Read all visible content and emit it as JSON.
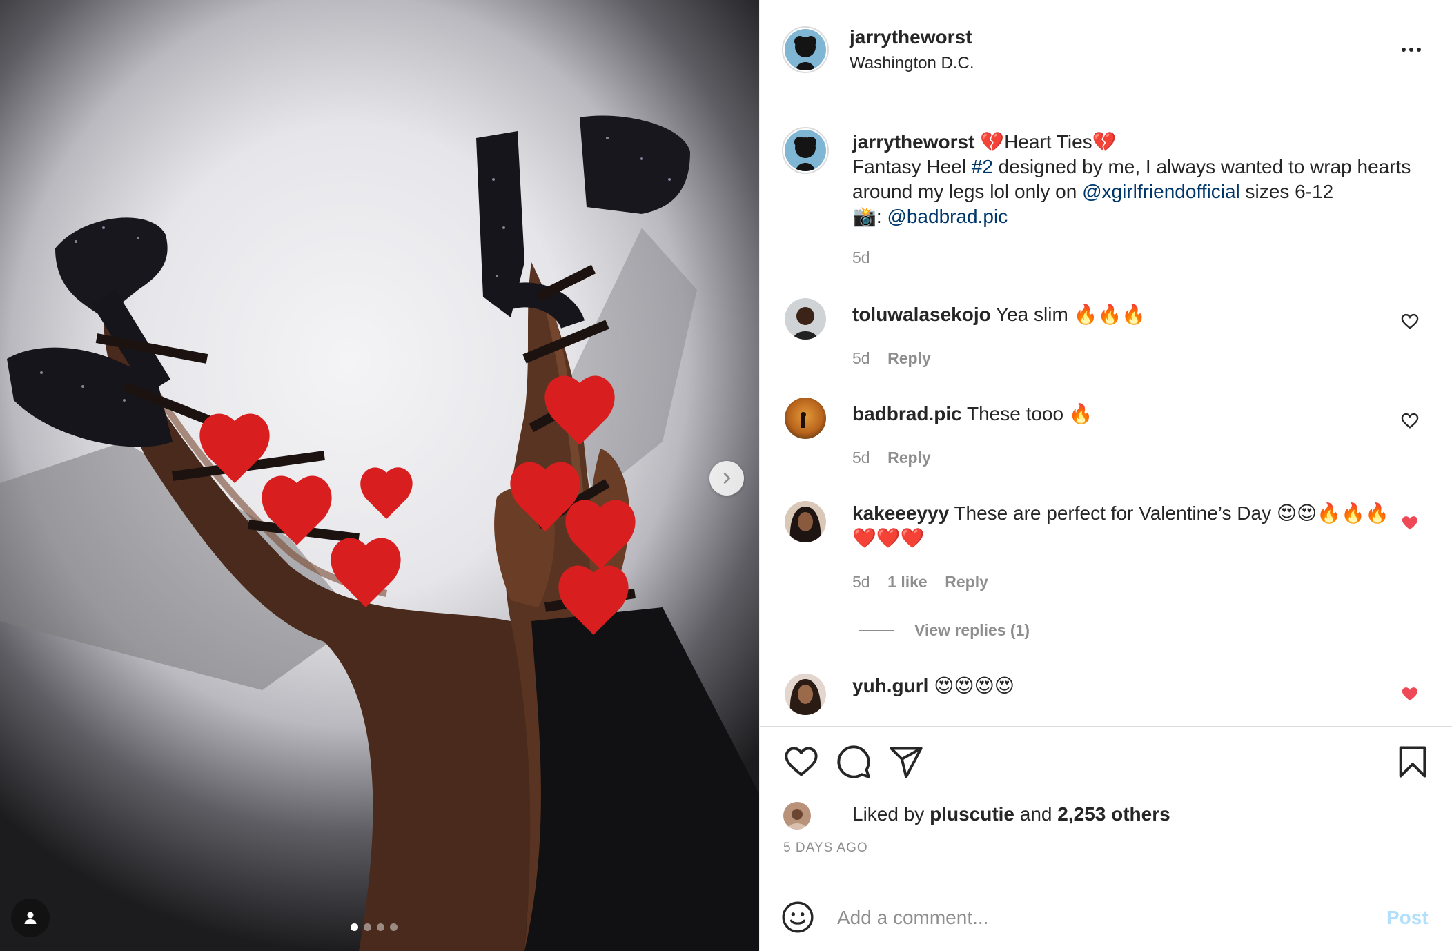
{
  "photo": {
    "alt_icon": "person-icon",
    "next_icon": "chevron-right-icon",
    "carousel": {
      "count": 4,
      "active": 1
    }
  },
  "header": {
    "username": "jarrytheworst",
    "location": "Washington D.C.",
    "more_icon": "more-horizontal-icon"
  },
  "caption": {
    "username": "jarrytheworst",
    "title_emoji_left": "💔",
    "title": "Heart Ties",
    "title_emoji_right": "💔",
    "line1_before": "Fantasy Heel ",
    "hashtag": "#2",
    "line1_after": " designed by me, I always wanted to wrap hearts around my legs lol only on ",
    "mention1": "@xgirlfriendofficial",
    "line2_after": " sizes 6-12",
    "camera_emoji": "📸",
    "credit_sep": ": ",
    "mention2": "@badbrad.pic",
    "age": "5d"
  },
  "comments": [
    {
      "username": "toluwalasekojo",
      "text": "Yea slim 🔥🔥🔥",
      "age": "5d",
      "likes": "",
      "reply": "Reply",
      "liked": false
    },
    {
      "username": "badbrad.pic",
      "text": "These tooo 🔥",
      "age": "5d",
      "likes": "",
      "reply": "Reply",
      "liked": false
    },
    {
      "username": "kakeeeyyy",
      "text": "These are perfect for Valentine’s Day 😍😍🔥🔥🔥 ❤️❤️❤️",
      "age": "5d",
      "likes": "1 like",
      "reply": "Reply",
      "liked": true,
      "view_replies": "View replies (1)"
    },
    {
      "username": "yuh.gurl",
      "text": "😍😍😍😍",
      "liked": true
    }
  ],
  "actions": {
    "like_icon": "heart-icon",
    "comment_icon": "comment-icon",
    "share_icon": "send-icon",
    "save_icon": "bookmark-icon"
  },
  "likes": {
    "prefix": "Liked by ",
    "user": "pluscutie",
    "and": " and ",
    "others": "2,253 others"
  },
  "timestamp": "5 DAYS AGO",
  "composer": {
    "emoji_icon": "smiley-icon",
    "placeholder": "Add a comment...",
    "post_label": "Post"
  },
  "colors": {
    "liked_heart": "#ed4956",
    "link": "#00376b",
    "post_disabled": "#b2dffc",
    "muted": "#8e8e8e"
  }
}
